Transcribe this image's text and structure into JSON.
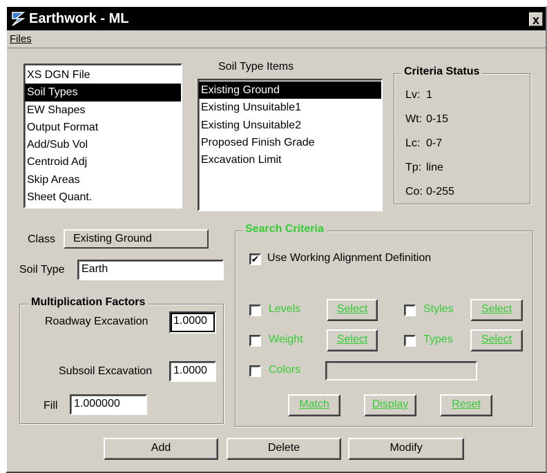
{
  "window": {
    "title": "Earthwork - ML",
    "close_label": "x"
  },
  "menu": {
    "files": "Files"
  },
  "categories": {
    "items": [
      "XS DGN File",
      "Soil Types",
      "EW Shapes",
      "Output Format",
      "Add/Sub Vol",
      "Centroid Adj",
      "Skip Areas",
      "Sheet Quant."
    ],
    "selected": "Soil Types"
  },
  "soil_items": {
    "label": "Soil Type Items",
    "items": [
      "Existing Ground",
      "Existing Unsuitable1",
      "Existing Unsuitable2",
      "Proposed Finish Grade",
      "Excavation Limit"
    ],
    "selected": "Existing Ground"
  },
  "criteria_status": {
    "title": "Criteria  Status",
    "rows": [
      {
        "key": "Lv:",
        "value": "1"
      },
      {
        "key": "Wt:",
        "value": "0-15"
      },
      {
        "key": "Lc:",
        "value": "0-7"
      },
      {
        "key": "Tp:",
        "value": "line"
      },
      {
        "key": "Co:",
        "value": "0-255"
      }
    ]
  },
  "class": {
    "label": "Class",
    "value": "Existing Ground"
  },
  "soil_type": {
    "label": "Soil Type",
    "value": "Earth"
  },
  "multiplication": {
    "title": "Multiplication Factors",
    "roadway_label": "Roadway Excavation",
    "roadway_value": "1.0000",
    "subsoil_label": "Subsoil Excavation",
    "subsoil_value": "1.0000",
    "fill_label": "Fill",
    "fill_value": "1.000000"
  },
  "search": {
    "title": "Search Criteria",
    "use_working_label": "Use Working Alignment Definition",
    "use_working_checked": true,
    "levels_label": "Levels",
    "styles_label": "Styles",
    "weight_label": "Weight",
    "types_label": "Types",
    "colors_label": "Colors",
    "colors_value": "",
    "select_label": "Select",
    "match_label": "Match",
    "display_label": "Display",
    "reset_label": "Reset",
    "accent_color": "#33cc33"
  },
  "actions": {
    "add": "Add",
    "delete": "Delete",
    "modify": "Modify"
  }
}
